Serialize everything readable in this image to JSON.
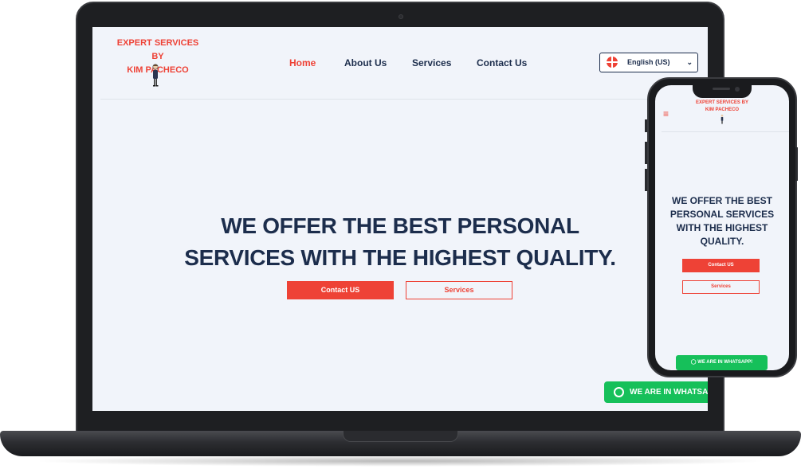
{
  "desktop": {
    "logo": {
      "line1": "EXPERT SERVICES BY",
      "line2": "KIM PACHECO"
    },
    "nav": [
      {
        "label": "Home",
        "active": true
      },
      {
        "label": "About Us",
        "active": false
      },
      {
        "label": "Services",
        "active": false
      },
      {
        "label": "Contact Us",
        "active": false
      }
    ],
    "language": {
      "selected": "English (US)",
      "icon": "globe-icon"
    },
    "hero": {
      "line1": "WE OFFER THE BEST PERSONAL",
      "line2": "SERVICES WITH THE HIGHEST QUALITY."
    },
    "buttons": {
      "primary": "Contact US",
      "secondary": "Services"
    },
    "whatsapp": {
      "label": "WE ARE IN WHATSAPP",
      "icon": "whatsapp-icon"
    }
  },
  "mobile": {
    "menu_icon": "hamburger-menu-icon",
    "logo": {
      "line1": "EXPERT SERVICES BY",
      "line2": "KIM PACHECO"
    },
    "hero": {
      "line1": "WE OFFER THE BEST",
      "line2": "PERSONAL SERVICES",
      "line3": "WITH THE HIGHEST",
      "line4": "QUALITY."
    },
    "buttons": {
      "primary": "Contact US",
      "secondary": "Services"
    },
    "whatsapp": {
      "label": "WE ARE IN WHATSAPP!",
      "icon": "whatsapp-icon"
    }
  },
  "colors": {
    "accent": "#ee4236",
    "navy": "#1c2d4c",
    "background": "#f1f4fa",
    "whatsapp": "#16c05a"
  }
}
